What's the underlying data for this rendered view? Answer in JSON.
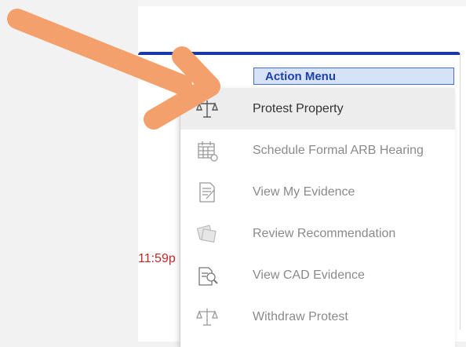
{
  "action_menu": {
    "label": "Action Menu"
  },
  "deadline": {
    "text": "11:59p"
  },
  "menu": {
    "items": [
      {
        "label": "Protest Property",
        "icon": "scales-icon",
        "active": true
      },
      {
        "label": "Schedule Formal ARB Hearing",
        "icon": "calendar-icon",
        "active": false
      },
      {
        "label": "View My Evidence",
        "icon": "document-edit-icon",
        "active": false
      },
      {
        "label": "Review Recommendation",
        "icon": "review-icon",
        "active": false
      },
      {
        "label": "View CAD Evidence",
        "icon": "document-search-icon",
        "active": false
      },
      {
        "label": "Withdraw Protest",
        "icon": "scales-icon",
        "active": false
      }
    ]
  },
  "colors": {
    "accent_blue": "#1a36a8",
    "deadline_red": "#c62828",
    "arrow_orange": "#f4a06c"
  }
}
